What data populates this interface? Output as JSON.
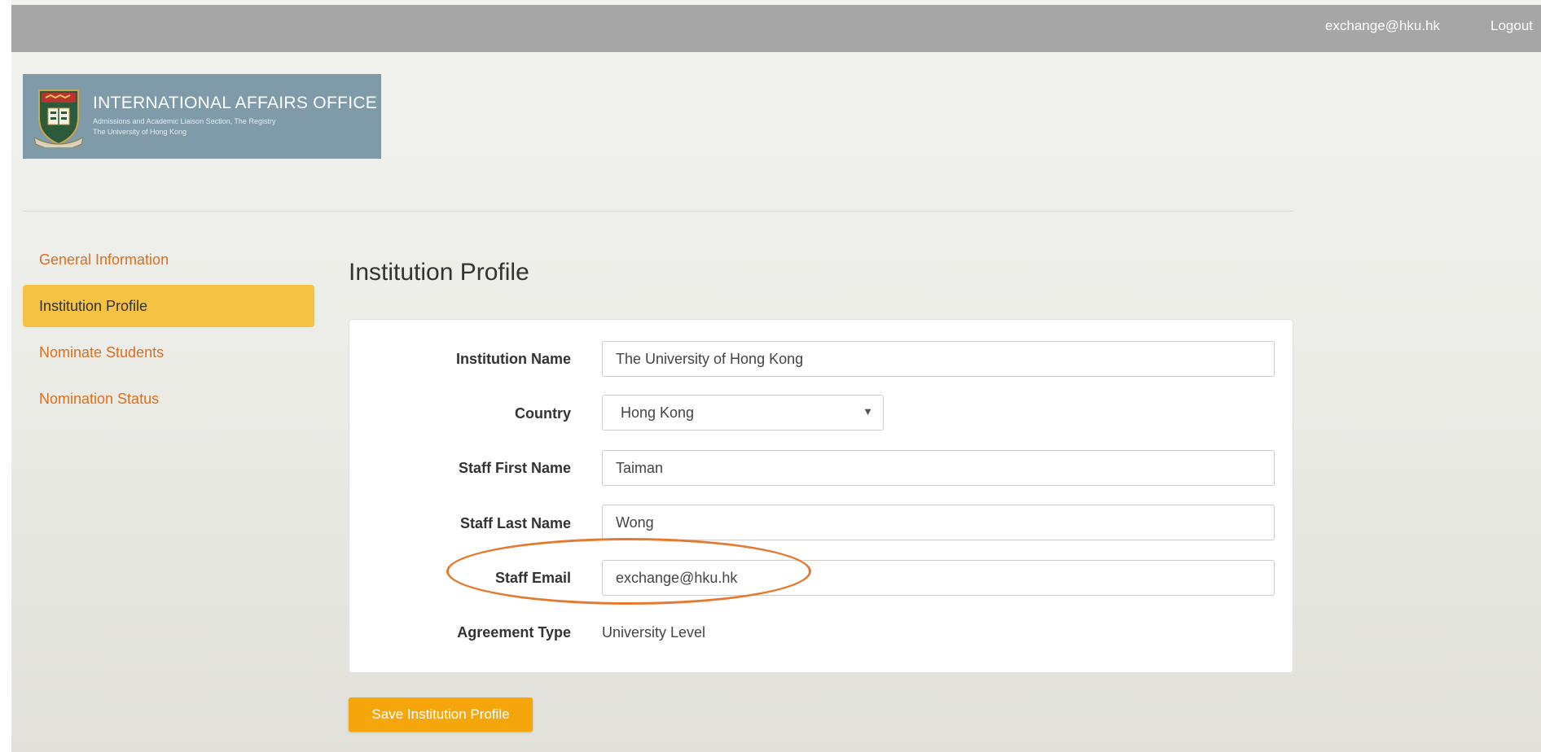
{
  "topbar": {
    "user_email": "exchange@hku.hk",
    "logout_label": "Logout"
  },
  "logo": {
    "title": "INTERNATIONAL AFFAIRS OFFICE",
    "subtitle_line1": "Admissions and Academic Liaison Section, The Registry",
    "subtitle_line2": "The University of Hong Kong"
  },
  "sidebar": {
    "items": [
      {
        "label": "General Information",
        "active": false
      },
      {
        "label": "Institution Profile",
        "active": true
      },
      {
        "label": "Nominate Students",
        "active": false
      },
      {
        "label": "Nomination Status",
        "active": false
      }
    ]
  },
  "main": {
    "title": "Institution Profile",
    "form": {
      "institution_name": {
        "label": "Institution Name",
        "value": "The University of Hong Kong"
      },
      "country": {
        "label": "Country",
        "value": "Hong Kong"
      },
      "staff_first_name": {
        "label": "Staff First Name",
        "value": "Taiman"
      },
      "staff_last_name": {
        "label": "Staff Last Name",
        "value": "Wong"
      },
      "staff_email": {
        "label": "Staff Email",
        "value": "exchange@hku.hk"
      },
      "agreement_type": {
        "label": "Agreement Type",
        "value": "University Level"
      }
    },
    "save_label": "Save Institution Profile"
  },
  "colors": {
    "accent": "#f6c243",
    "link": "#d96f1f",
    "button": "#f5a60a",
    "highlight_ring": "#e37a2f",
    "topbar": "#a6a6a6",
    "logo_bg": "#7f9aa9"
  },
  "icons": {
    "logo": "hku-crest-icon",
    "dropdown": "caret-down-icon"
  }
}
